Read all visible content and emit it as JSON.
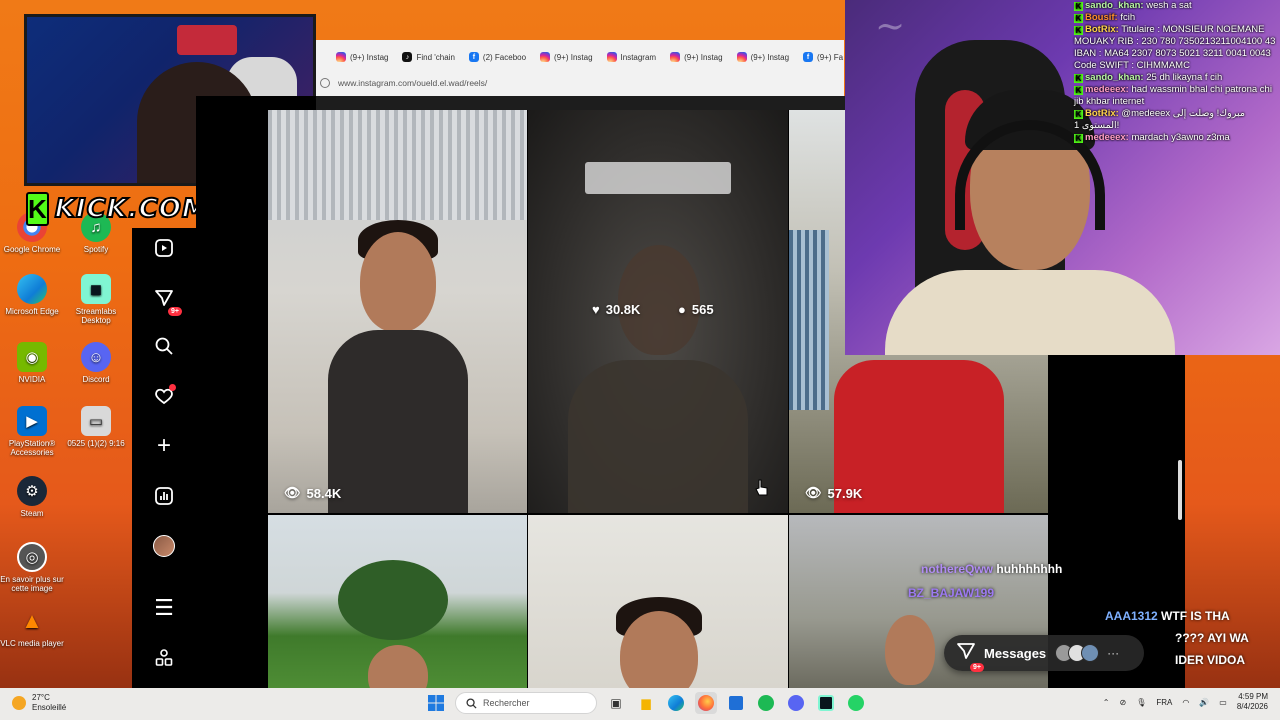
{
  "desktop": {
    "icons": [
      {
        "label": "Google Chrome",
        "color": "#4285f4"
      },
      {
        "label": "Spotify",
        "color": "#1db954"
      },
      {
        "label": "Microsoft Edge",
        "color": "#0f7dd6"
      },
      {
        "label": "Streamlabs Desktop",
        "color": "#80f5d2"
      },
      {
        "label": "NVIDIA",
        "color": "#76b900"
      },
      {
        "label": "Discord",
        "color": "#5865f2"
      },
      {
        "label": "PlayStation® Accessories",
        "color": "#0070d1"
      },
      {
        "label": "0525 (1)(2) 9:16",
        "color": "#d9d9d9"
      },
      {
        "label": "Steam",
        "color": "#1b2838"
      },
      {
        "label": "En savoir plus sur cette image",
        "color": "#555555"
      },
      {
        "label": "VLC media player",
        "color": "#ff8800"
      }
    ]
  },
  "overlay": {
    "kick_letter": "K",
    "kick_text": "KICK.COM/BOUSIF",
    "kick_color": "#53fc18"
  },
  "browser": {
    "tabs": [
      {
        "label": "(9+) Instag",
        "icon": "instagram-icon"
      },
      {
        "label": "Find 'chain",
        "icon": "tiktok-icon"
      },
      {
        "label": "(2) Faceboo",
        "icon": "facebook-icon"
      },
      {
        "label": "(9+) Instag",
        "icon": "instagram-icon"
      },
      {
        "label": "Instagram",
        "icon": "instagram-icon"
      },
      {
        "label": "(9+) Instag",
        "icon": "instagram-icon"
      },
      {
        "label": "(9+) Instag",
        "icon": "instagram-icon"
      },
      {
        "label": "(9+) Fa",
        "icon": "facebook-icon"
      }
    ],
    "url": "www.instagram.com/oueld.el.wad/reels/"
  },
  "instagram": {
    "sidebar": {
      "notifications_badge": "9+"
    },
    "reels": [
      {
        "views": "58.4K"
      },
      {
        "likes": "30.8K",
        "comments": "565"
      },
      {
        "views": "57.9K"
      }
    ],
    "messages_label": "Messages",
    "messages_badge": "9+"
  },
  "chat": {
    "messages": [
      {
        "user": "sando_khan:",
        "text": " wesh a sat"
      },
      {
        "user": "Bousif:",
        "text": " fcih"
      },
      {
        "user": "BotRix:",
        "text": " Titulaire : MONSIEUR NOEMANE MOUAKY RIB : 230 780 7350213211004100 43 IBAN : MA64 2307 8073 5021 3211 0041 0043 Code SWIFT : CIHMMAMC"
      },
      {
        "user": "sando_khan:",
        "text": " 25 dh likayna f cih"
      },
      {
        "user": "medeeex:",
        "text": " had wassmin bhal chi patrona chi jib khbar internet"
      },
      {
        "user": "BotRix:",
        "text": " @medeeex مبروك! وصلت إلى المستوى 1!"
      },
      {
        "user": "medeeex:",
        "text": " mardach y3awno z3ma"
      }
    ],
    "floating": [
      {
        "user": "nothereQww",
        "text": "huhhhhhhh"
      },
      {
        "user": "BZ_BAJAW199",
        "text": ""
      },
      {
        "user": "AAA1312",
        "text": "WTF IS THA"
      },
      {
        "user": "",
        "text": "???? AYI WA"
      },
      {
        "user": "",
        "text": "IDER VIDOA"
      }
    ]
  },
  "taskbar": {
    "weather_temp": "27°C",
    "weather_desc": "Ensoleillé",
    "search_placeholder": "Rechercher",
    "language": "FRA",
    "time": "4:59 PM",
    "date": "8/4/2026"
  }
}
